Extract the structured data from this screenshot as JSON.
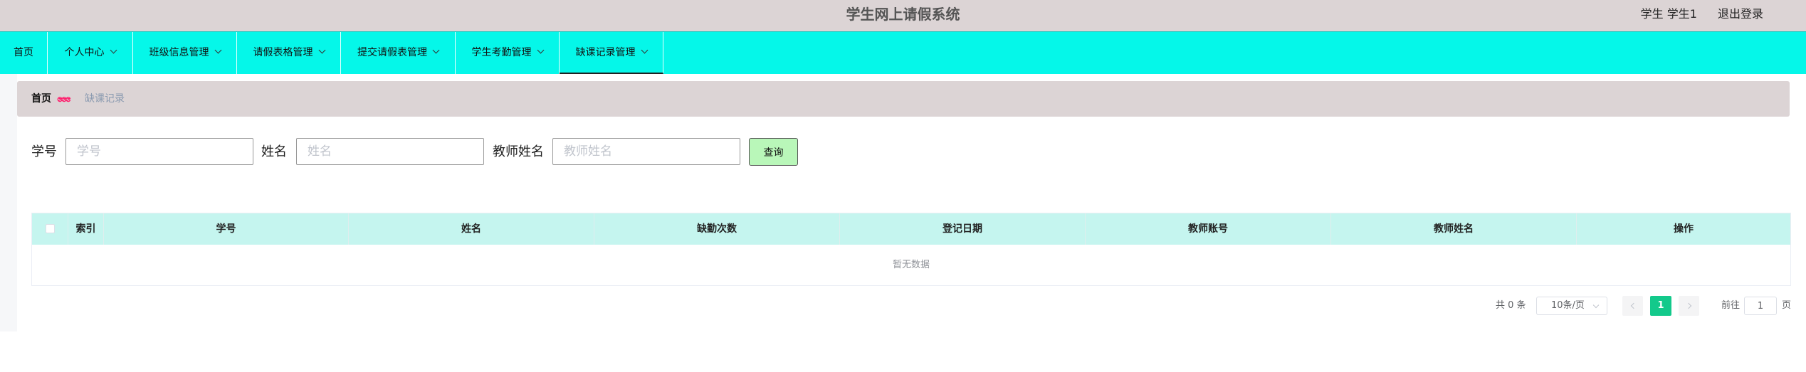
{
  "header": {
    "title": "学生网上请假系统",
    "user_label": "学生 学生1",
    "logout_label": "退出登录"
  },
  "nav": {
    "items": [
      {
        "label": "首页",
        "has_dropdown": false
      },
      {
        "label": "个人中心",
        "has_dropdown": true
      },
      {
        "label": "班级信息管理",
        "has_dropdown": true
      },
      {
        "label": "请假表格管理",
        "has_dropdown": true
      },
      {
        "label": "提交请假表管理",
        "has_dropdown": true
      },
      {
        "label": "学生考勤管理",
        "has_dropdown": true
      },
      {
        "label": "缺课记录管理",
        "has_dropdown": true,
        "active": true
      }
    ]
  },
  "breadcrumb": {
    "home": "首页",
    "separator": "ဧဧဧ",
    "current": "缺课记录"
  },
  "search": {
    "student_id_label": "学号",
    "student_id_placeholder": "学号",
    "name_label": "姓名",
    "name_placeholder": "姓名",
    "teacher_name_label": "教师姓名",
    "teacher_name_placeholder": "教师姓名",
    "query_button": "查询"
  },
  "table": {
    "columns": [
      "索引",
      "学号",
      "姓名",
      "缺勤次数",
      "登记日期",
      "教师账号",
      "教师姓名",
      "操作"
    ],
    "rows": [],
    "empty_text": "暂无数据"
  },
  "pagination": {
    "total_label": "共 0 条",
    "page_size": "10条/页",
    "current_page": "1",
    "goto_label": "前往",
    "goto_value": "1",
    "page_suffix": "页"
  },
  "colors": {
    "header_bg": "#dcd4d5",
    "nav_bg": "#05f7e9",
    "table_header_bg": "#c5f5ef",
    "query_button_bg": "#b9f7b9",
    "active_page_bg": "#13c98b",
    "breadcrumb_separator": "#ff1a6a"
  }
}
